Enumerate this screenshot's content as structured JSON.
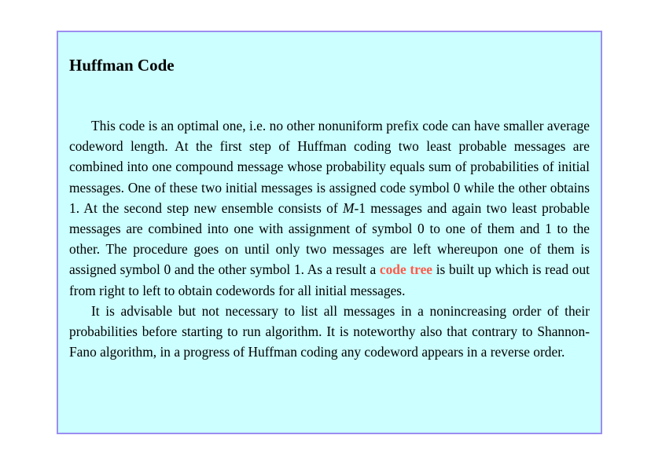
{
  "title": "Huffman Code",
  "paragraph1": {
    "part1": "This code is an optimal one, i.e. no other nonuniform prefix code can have smaller average codeword length. At the first step of Huffman coding two least probable messages are combined into one compound message whose probability equals sum of probabilities of initial messages. One of these two initial messages is assigned code symbol 0 while the other obtains 1. At the second step new ensemble consists of ",
    "var": "M",
    "part2": "-1 messages and again two least probable messages are combined into one with assignment of symbol 0 to one of them and 1 to the other. The procedure goes on until only two messages are left whereupon one of them is assigned symbol 0 and the other symbol 1. As a result a ",
    "highlight": "code tree",
    "part3": " is built up which is read out from right to left to obtain codewords for all initial messages."
  },
  "paragraph2": "It is advisable but not necessary to list all messages in a nonincreasing order of their probabilities before starting to run algorithm. It is noteworthy also that contrary to Shannon-Fano algorithm, in a progress of Huffman coding any codeword appears in a reverse order.",
  "colors": {
    "box_background": "#ccffff",
    "box_border": "#9b8ef0",
    "highlight": "#ff5a4a"
  }
}
